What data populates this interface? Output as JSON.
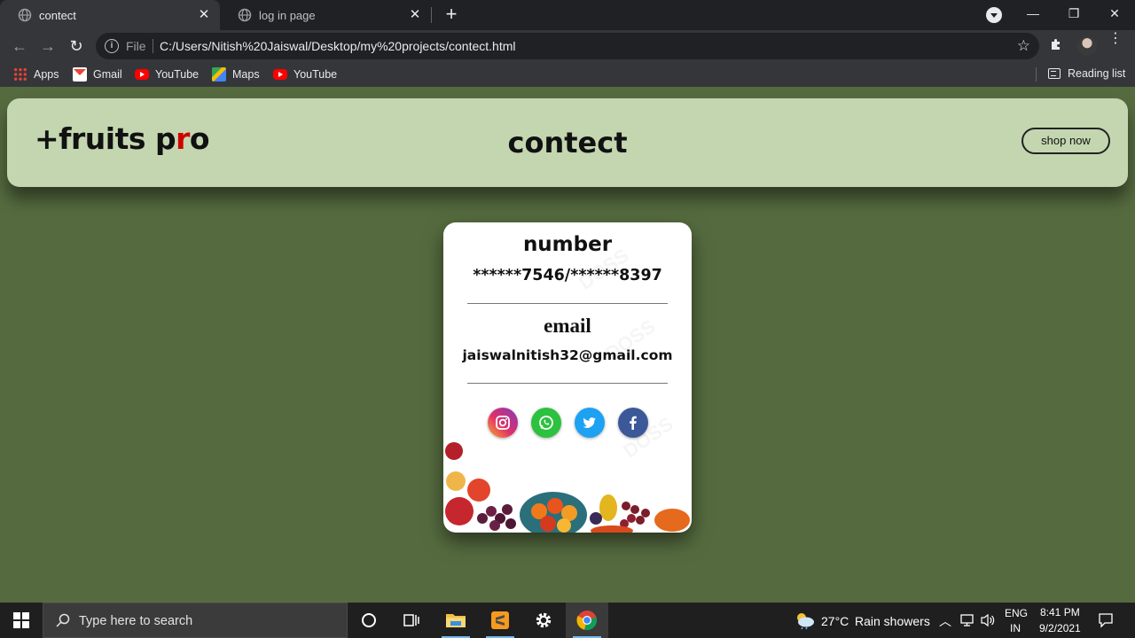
{
  "browser": {
    "tabs": [
      {
        "title": "contect",
        "active": true
      },
      {
        "title": "log in page",
        "active": false
      }
    ],
    "address": {
      "scheme_label": "File",
      "url": "C:/Users/Nitish%20Jaiswal/Desktop/my%20projects/contect.html"
    },
    "bookmarks": [
      {
        "label": "Apps",
        "icon": "apps-icon"
      },
      {
        "label": "Gmail",
        "icon": "gmail-icon"
      },
      {
        "label": "YouTube",
        "icon": "youtube-icon"
      },
      {
        "label": "Maps",
        "icon": "maps-icon"
      },
      {
        "label": "YouTube",
        "icon": "youtube-icon"
      }
    ],
    "reading_list": "Reading list"
  },
  "site": {
    "brand_main": "+fruits p",
    "brand_accent": "r",
    "brand_end": "o",
    "heading": "contect",
    "shop_button": "shop now",
    "colors": {
      "page_bg": "#556b3f",
      "header_bg": "#c3d6b0",
      "brand_accent": "#d10000"
    }
  },
  "card": {
    "number_title": "number",
    "number_value": "******7546/******8397",
    "email_title": "email",
    "email_value": "jaiswalnitish32@gmail.com",
    "socials": [
      "instagram-icon",
      "whatsapp-icon",
      "twitter-icon",
      "facebook-icon"
    ]
  },
  "taskbar": {
    "search_placeholder": "Type here to search",
    "weather_temp": "27°C",
    "weather_text": "Rain showers",
    "lang_top": "ENG",
    "lang_bottom": "IN",
    "time": "8:41 PM",
    "date": "9/2/2021"
  }
}
